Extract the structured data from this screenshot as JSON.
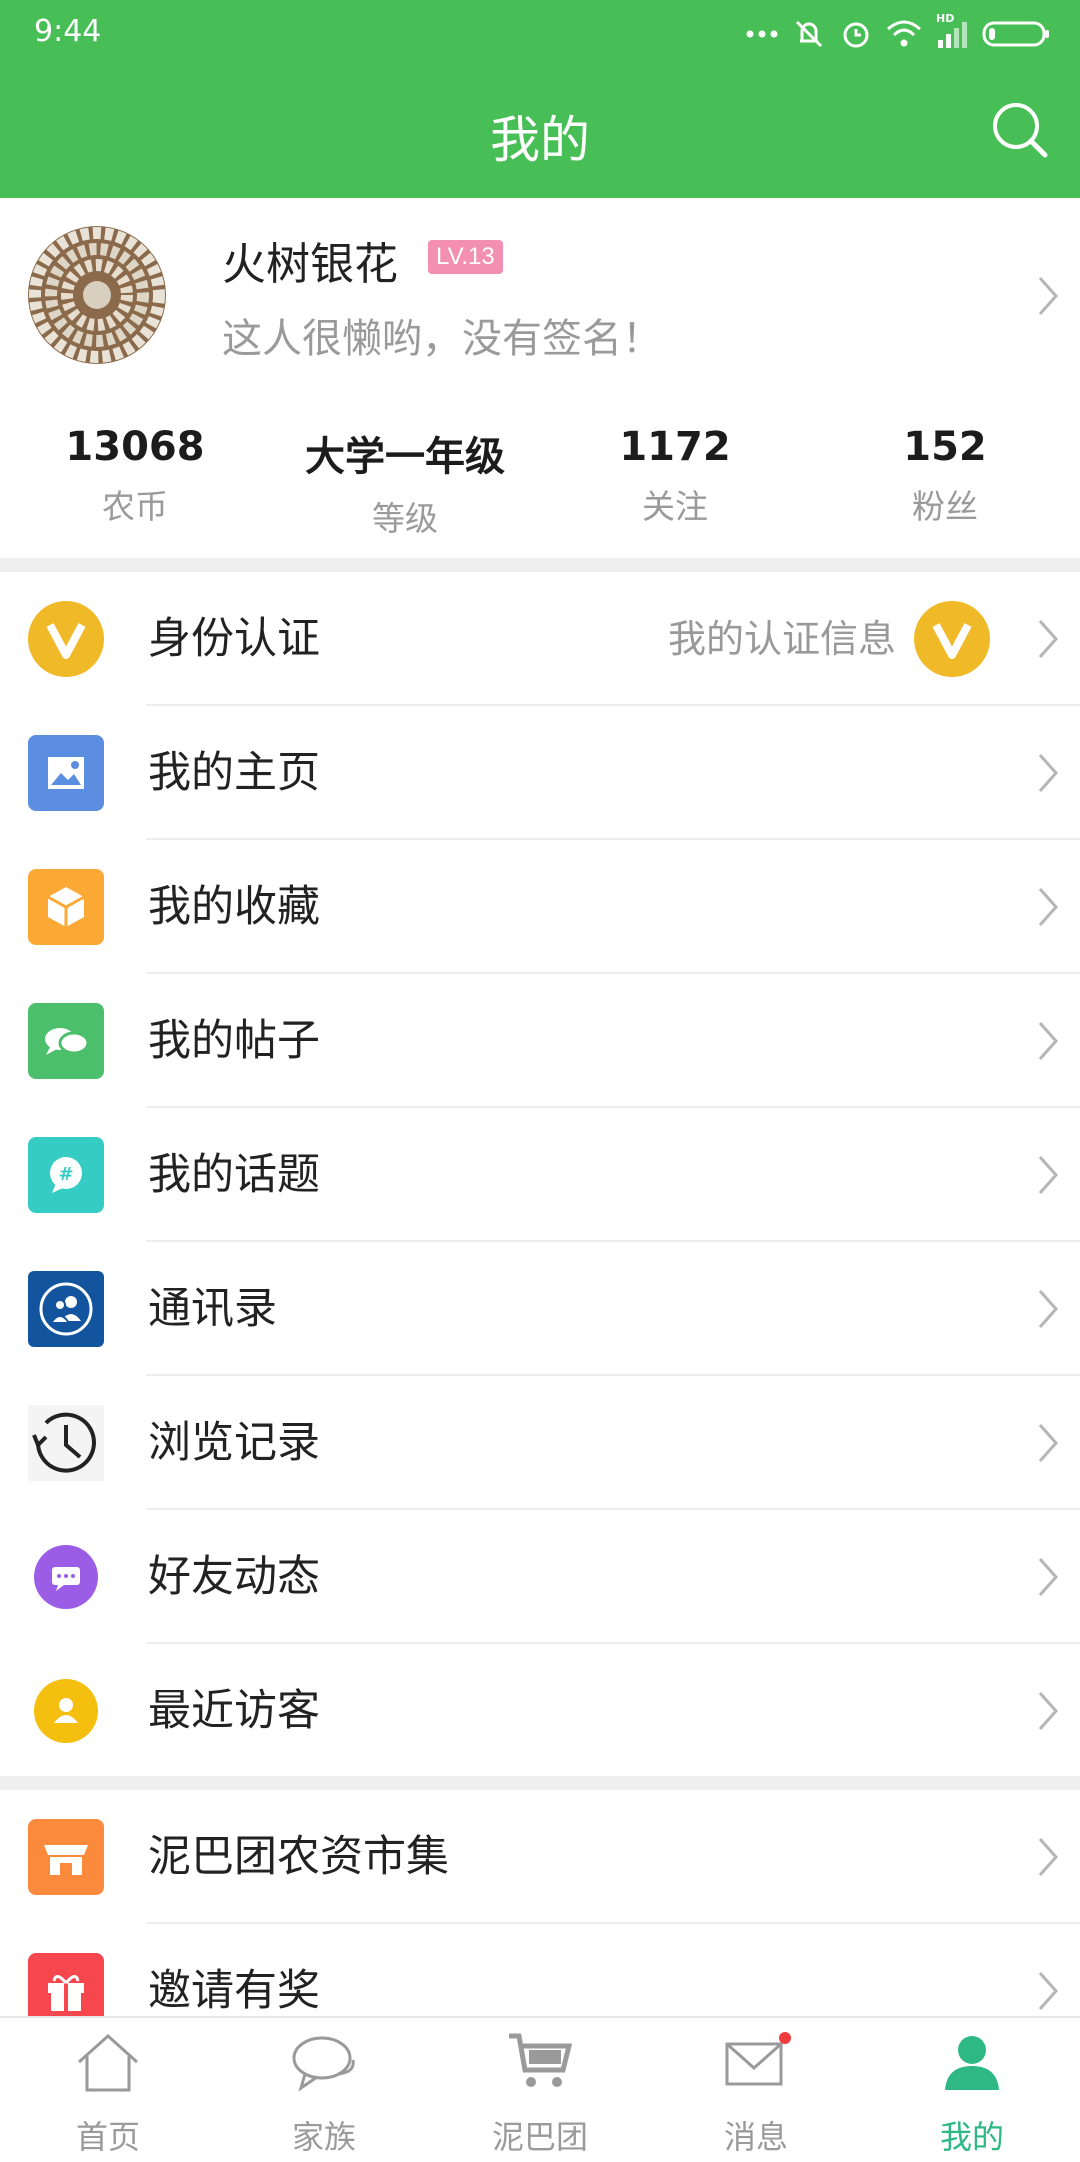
{
  "status_bar": {
    "time": "9:44",
    "network_label": "HD"
  },
  "header": {
    "title": "我的",
    "search_icon": "search-icon"
  },
  "profile": {
    "name": "火树银花",
    "level": "LV.13",
    "signature": "这人很懒哟，没有签名！",
    "stats": [
      {
        "value": "13068",
        "label": "农币"
      },
      {
        "value": "大学一年级",
        "label": "等级"
      },
      {
        "value": "1172",
        "label": "关注"
      },
      {
        "value": "152",
        "label": "粉丝"
      }
    ]
  },
  "menu_group_1": [
    {
      "label": "身份认证",
      "icon": "verified-v-icon",
      "right_text": "我的认证信息"
    },
    {
      "label": "我的主页",
      "icon": "image-icon"
    },
    {
      "label": "我的收藏",
      "icon": "box-icon"
    },
    {
      "label": "我的帖子",
      "icon": "chat-bubbles-icon"
    },
    {
      "label": "我的话题",
      "icon": "hashtag-icon"
    },
    {
      "label": "通讯录",
      "icon": "contacts-icon"
    },
    {
      "label": "浏览记录",
      "icon": "history-icon"
    },
    {
      "label": "好友动态",
      "icon": "message-dots-icon"
    },
    {
      "label": "最近访客",
      "icon": "visitor-icon"
    }
  ],
  "menu_group_2": [
    {
      "label": "泥巴团农资市集",
      "icon": "store-icon"
    },
    {
      "label": "邀请有奖",
      "icon": "gift-icon"
    }
  ],
  "bottom_nav": [
    {
      "label": "首页",
      "icon": "home-icon"
    },
    {
      "label": "家族",
      "icon": "chat-icon"
    },
    {
      "label": "泥巴团",
      "icon": "cart-icon"
    },
    {
      "label": "消息",
      "icon": "mail-icon"
    },
    {
      "label": "我的",
      "icon": "user-icon"
    }
  ],
  "colors": {
    "header": "#48bf56",
    "active_tab": "#2eb884",
    "level_badge": "#f38fb0",
    "verify_badge": "#f0b928",
    "notification_dot": "#f03c3c"
  }
}
